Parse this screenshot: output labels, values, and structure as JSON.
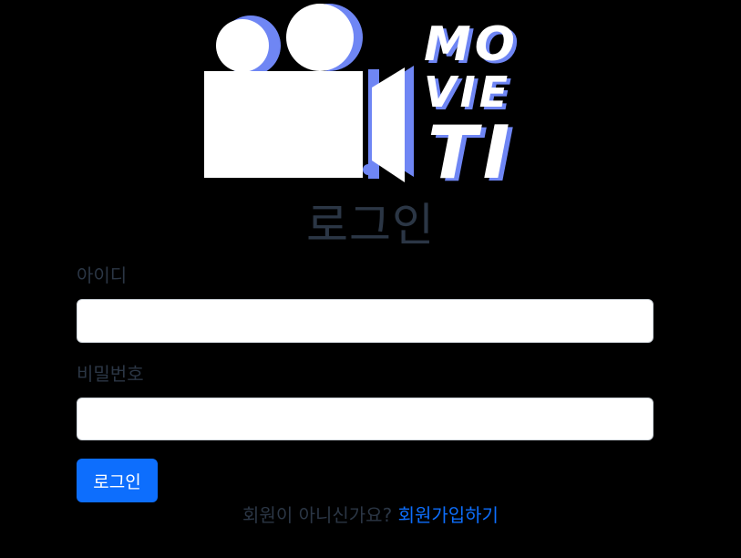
{
  "logo": {
    "wordmark_lines": [
      "MO",
      "VIE",
      "TI"
    ],
    "icon": "movie-camera-icon",
    "colors": {
      "fill": "#ffffff",
      "shadow": "#6f86f4"
    }
  },
  "login": {
    "title": "로그인",
    "id_label": "아이디",
    "id_value": "",
    "password_label": "비밀번호",
    "password_value": "",
    "submit_label": "로그인"
  },
  "signup": {
    "prompt": "회원이 아니신가요?",
    "link_label": "회원가입하기"
  },
  "colors": {
    "background": "#000000",
    "accent": "#0d6efd",
    "muted_text": "#2b3645"
  }
}
